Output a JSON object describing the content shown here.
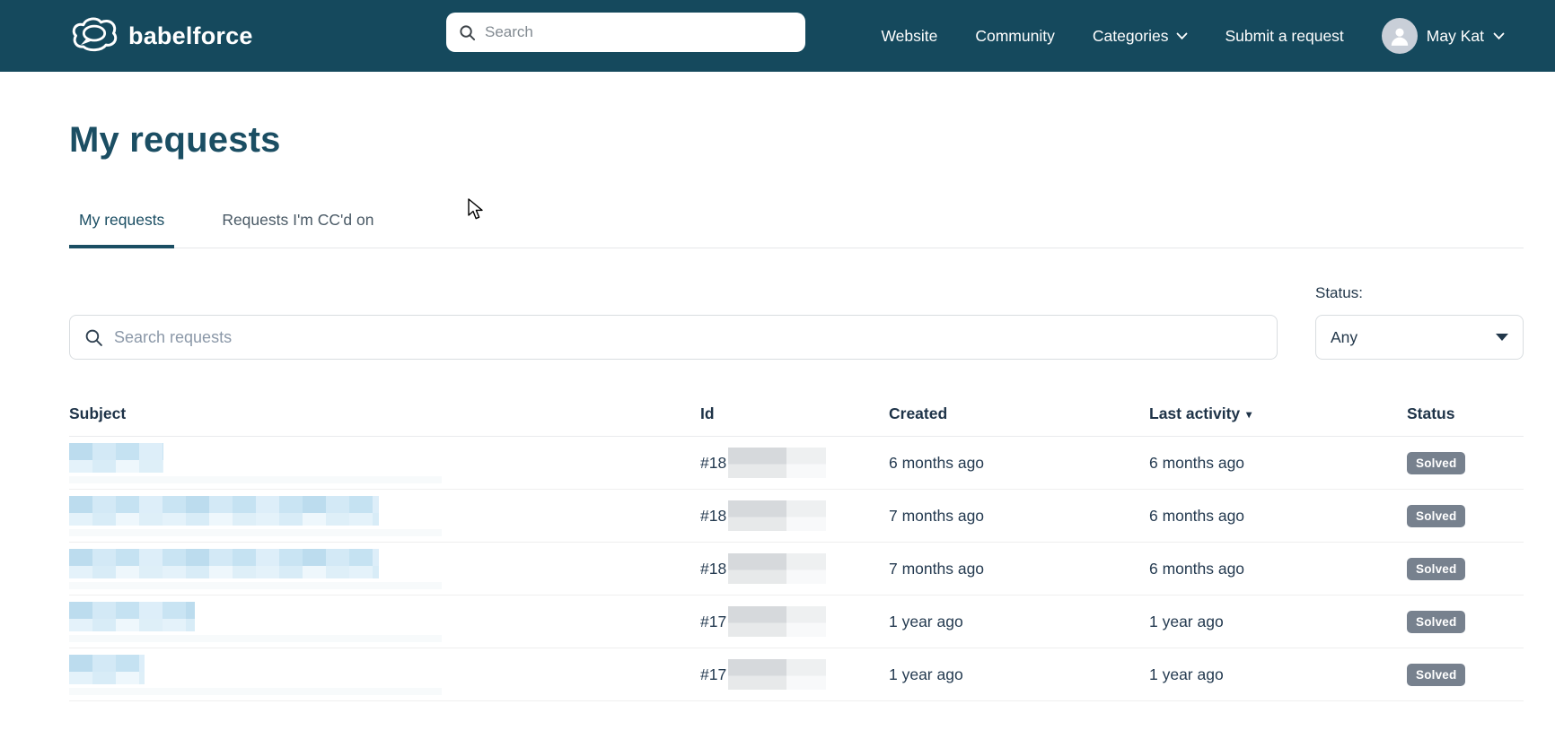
{
  "navbar": {
    "brand": "babelforce",
    "search_placeholder": "Search",
    "links": {
      "website": "Website",
      "community": "Community",
      "categories": "Categories",
      "submit_request": "Submit a request"
    },
    "user_name": "May Kat"
  },
  "page": {
    "title": "My requests",
    "tabs": {
      "my_requests": "My requests",
      "ccd_on": "Requests I'm CC'd on"
    },
    "filters": {
      "search_placeholder": "Search requests",
      "status_label": "Status:",
      "status_value": "Any"
    },
    "table": {
      "headers": {
        "subject": "Subject",
        "id": "Id",
        "created": "Created",
        "last_activity": "Last activity",
        "status": "Status"
      },
      "sorted_by": "Last activity",
      "rows": [
        {
          "subject_redacted": true,
          "subject_redacted_width": 105,
          "id_prefix": "#18",
          "id_redacted": true,
          "created": "6 months ago",
          "last_activity": "6 months ago",
          "status": "Solved"
        },
        {
          "subject_redacted": true,
          "subject_redacted_width": 345,
          "id_prefix": "#18",
          "id_redacted": true,
          "created": "7 months ago",
          "last_activity": "6 months ago",
          "status": "Solved"
        },
        {
          "subject_redacted": true,
          "subject_redacted_width": 345,
          "id_prefix": "#18",
          "id_redacted": true,
          "created": "7 months ago",
          "last_activity": "6 months ago",
          "status": "Solved"
        },
        {
          "subject_redacted": true,
          "subject_redacted_width": 140,
          "id_prefix": "#17",
          "id_redacted": true,
          "created": "1 year ago",
          "last_activity": "1 year ago",
          "status": "Solved"
        },
        {
          "subject_redacted": true,
          "subject_redacted_width": 84,
          "id_prefix": "#17",
          "id_redacted": true,
          "created": "1 year ago",
          "last_activity": "1 year ago",
          "status": "Solved"
        }
      ]
    }
  },
  "colors": {
    "navbar_bg": "#15495d",
    "accent": "#1b4e63",
    "badge_bg": "#77818e",
    "redact_blue": "#cde5f4",
    "redact_gray": "#d9dcdf"
  }
}
